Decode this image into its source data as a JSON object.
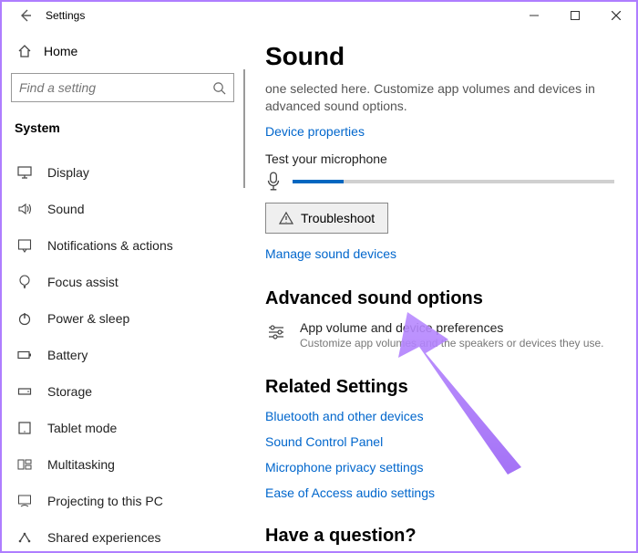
{
  "titlebar": {
    "title": "Settings"
  },
  "sidebar": {
    "home": "Home",
    "search_placeholder": "Find a setting",
    "category": "System",
    "items": [
      {
        "label": "Display"
      },
      {
        "label": "Sound"
      },
      {
        "label": "Notifications & actions"
      },
      {
        "label": "Focus assist"
      },
      {
        "label": "Power & sleep"
      },
      {
        "label": "Battery"
      },
      {
        "label": "Storage"
      },
      {
        "label": "Tablet mode"
      },
      {
        "label": "Multitasking"
      },
      {
        "label": "Projecting to this PC"
      },
      {
        "label": "Shared experiences"
      }
    ]
  },
  "main": {
    "title": "Sound",
    "desc": "one selected here. Customize app volumes and devices in advanced sound options.",
    "device_properties": "Device properties",
    "test_mic": "Test your microphone",
    "troubleshoot": "Troubleshoot",
    "manage_devices": "Manage sound devices",
    "advanced_heading": "Advanced sound options",
    "adv_item_title": "App volume and device preferences",
    "adv_item_sub": "Customize app volumes and the speakers or devices they use.",
    "related_heading": "Related Settings",
    "related_links": [
      "Bluetooth and other devices",
      "Sound Control Panel",
      "Microphone privacy settings",
      "Ease of Access audio settings"
    ],
    "question_heading": "Have a question?"
  }
}
